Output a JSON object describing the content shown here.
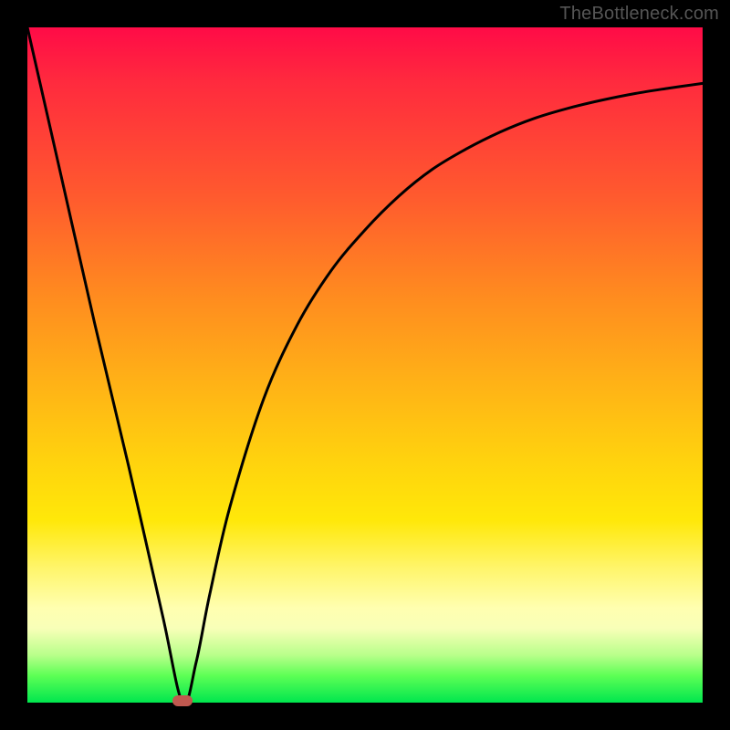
{
  "watermark": "TheBottleneck.com",
  "colors": {
    "frame": "#000000",
    "curve": "#000000",
    "marker": "#c0584f",
    "gradient_top": "#ff0b47",
    "gradient_bottom": "#00e64e"
  },
  "chart_data": {
    "type": "line",
    "title": "",
    "xlabel": "",
    "ylabel": "",
    "xlim": [
      0,
      100
    ],
    "ylim": [
      0,
      100
    ],
    "series": [
      {
        "name": "bottleneck-curve",
        "x": [
          0,
          5,
          10,
          15,
          20,
          23,
          25,
          27,
          30,
          35,
          40,
          45,
          50,
          55,
          60,
          65,
          70,
          75,
          80,
          85,
          90,
          95,
          100
        ],
        "values": [
          100,
          78,
          56,
          35,
          13,
          0,
          6,
          16,
          29,
          45,
          56,
          64,
          70,
          75,
          79,
          82,
          84.5,
          86.5,
          88,
          89.2,
          90.2,
          91,
          91.7
        ]
      }
    ],
    "annotations": [
      {
        "name": "min-marker",
        "x": 23,
        "y": 0
      }
    ]
  }
}
